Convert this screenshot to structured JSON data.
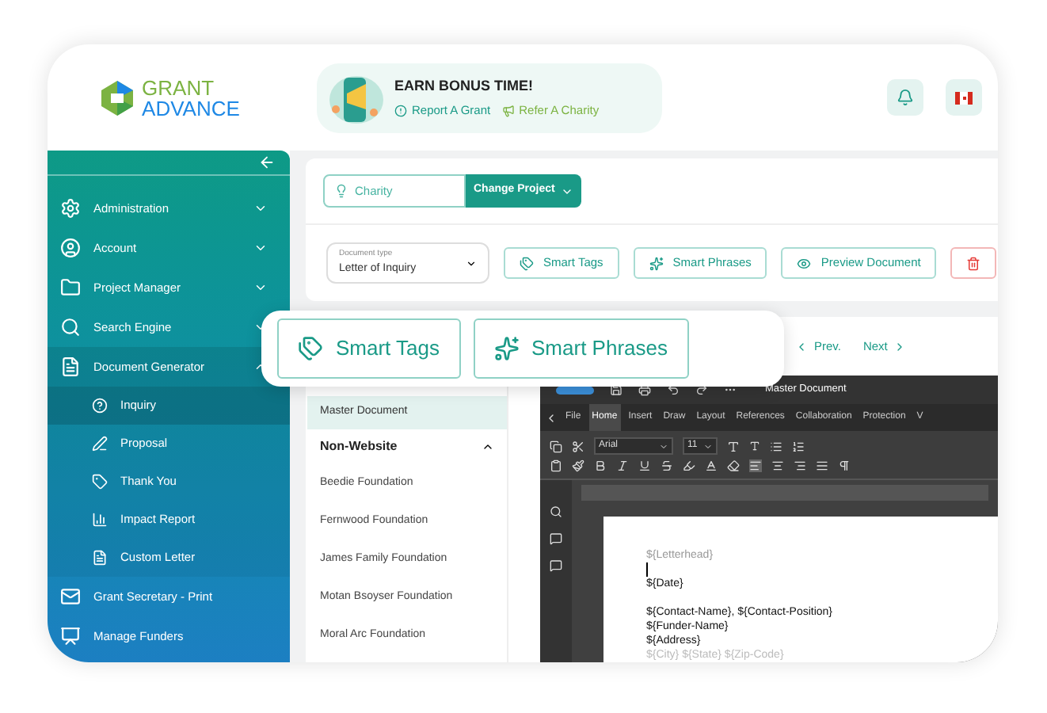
{
  "logo": {
    "line1": "GRANT",
    "line2": "ADVANCE"
  },
  "bonus": {
    "title": "EARN BONUS TIME!",
    "links": [
      "Report A Grant",
      "Refer A Charity"
    ]
  },
  "sidebar": {
    "items": [
      {
        "label": "Administration",
        "expanded": false
      },
      {
        "label": "Account",
        "expanded": false
      },
      {
        "label": "Project Manager",
        "expanded": false
      },
      {
        "label": "Search Engine",
        "expanded": false
      },
      {
        "label": "Document Generator",
        "expanded": true,
        "children": [
          {
            "label": "Inquiry",
            "selected": true
          },
          {
            "label": "Proposal",
            "selected": false
          },
          {
            "label": "Thank You",
            "selected": false
          },
          {
            "label": "Impact Report",
            "selected": false
          },
          {
            "label": "Custom Letter",
            "selected": false
          }
        ]
      },
      {
        "label": "Grant Secretary - Print"
      },
      {
        "label": "Manage Funders"
      }
    ]
  },
  "project": {
    "field": "Charity",
    "button": "Change Project"
  },
  "document_type": {
    "label": "Document type",
    "value": "Letter of Inquiry"
  },
  "actions": [
    {
      "kind": "tags",
      "label": "Smart Tags"
    },
    {
      "kind": "phrases",
      "label": "Smart Phrases"
    },
    {
      "kind": "preview",
      "label": "Preview Document"
    },
    {
      "kind": "delete"
    }
  ],
  "callout": [
    {
      "kind": "tags",
      "label": "Smart Tags"
    },
    {
      "kind": "phrases",
      "label": "Smart Phrases"
    }
  ],
  "documents": {
    "master": {
      "label": "Master Document",
      "selected": true
    },
    "group": {
      "label": "Non-Website",
      "expanded": true,
      "items": [
        "Beedie Foundation",
        "Fernwood Foundation",
        "James Family Foundation",
        "Motan Bsoyser Foundation",
        "Moral Arc Foundation"
      ]
    }
  },
  "pager": {
    "prev": "Prev.",
    "next": "Next"
  },
  "editor": {
    "title": "Master Document",
    "menu": [
      {
        "label": "File",
        "selected": false
      },
      {
        "label": "Home",
        "selected": true
      },
      {
        "label": "Insert",
        "selected": false
      },
      {
        "label": "Draw",
        "selected": false
      },
      {
        "label": "Layout",
        "selected": false
      },
      {
        "label": "References",
        "selected": false
      },
      {
        "label": "Collaboration",
        "selected": false
      },
      {
        "label": "Protection",
        "selected": false
      },
      {
        "label": "V",
        "selected": false
      }
    ],
    "font": "Arial",
    "size": "11",
    "lines": [
      {
        "kind": "muted",
        "text": "${Letterhead}"
      },
      {
        "kind": "cursor"
      },
      {
        "kind": "text",
        "text": "${Date}"
      },
      {
        "kind": "blank"
      },
      {
        "kind": "text",
        "text": "${Contact-Name}, ${Contact-Position}"
      },
      {
        "kind": "text",
        "text": "${Funder-Name}"
      },
      {
        "kind": "text",
        "text": "${Address}"
      },
      {
        "kind": "faded",
        "text": "${City} ${State} ${Zip-Code}"
      }
    ]
  }
}
